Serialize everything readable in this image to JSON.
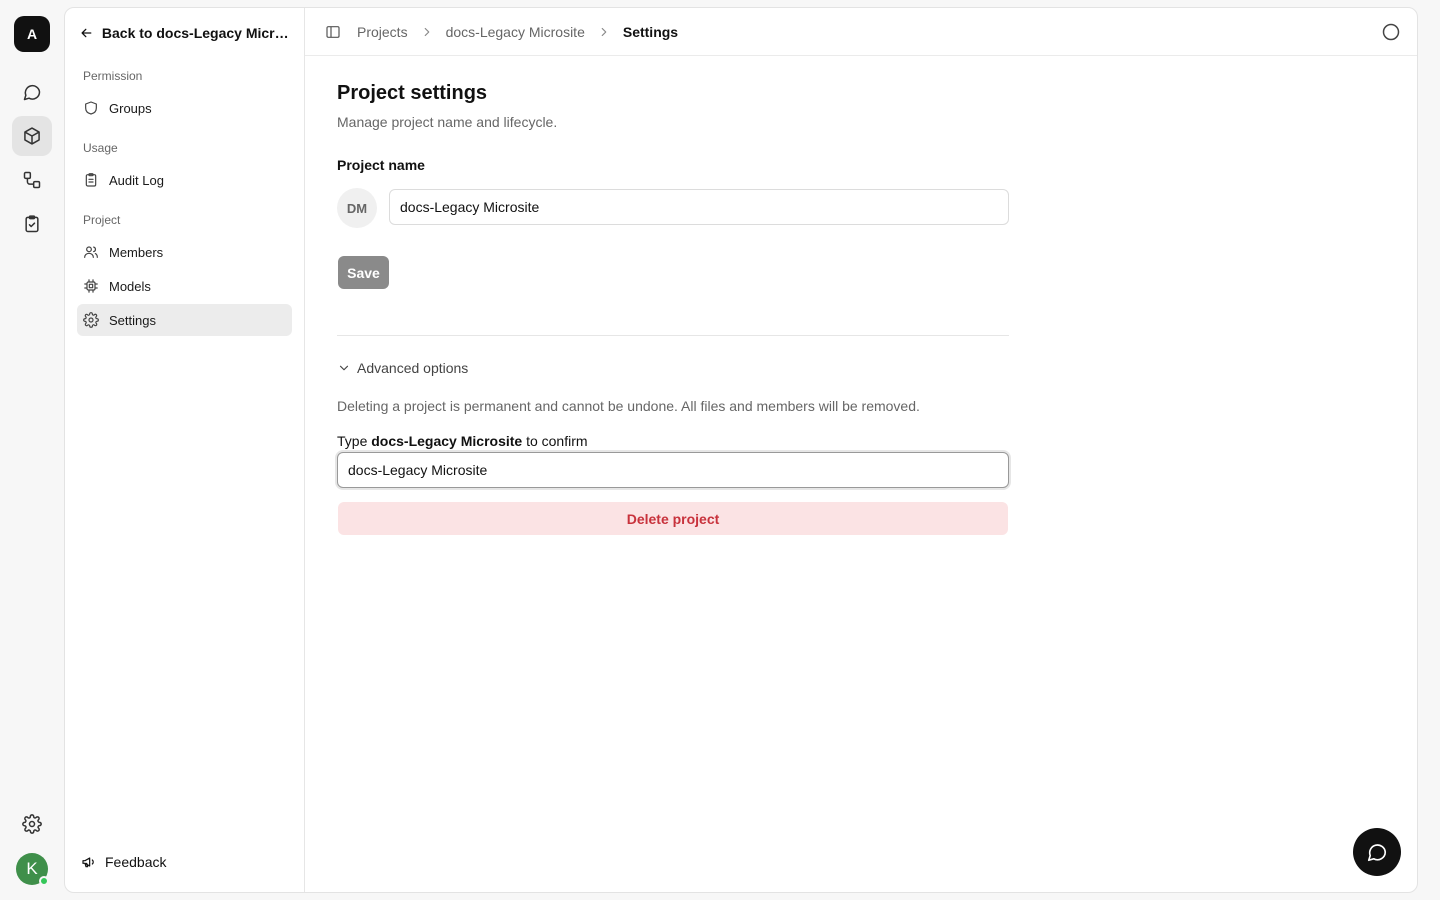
{
  "rail": {
    "logo_letter": "A",
    "avatar_letter": "K",
    "icons": [
      "chat-icon",
      "cube-icon",
      "workflow-icon",
      "clipboard-check-icon",
      "gear-icon"
    ]
  },
  "sidebar": {
    "back_label": "Back to docs-Legacy Microsite",
    "sections": {
      "permission": "Permission",
      "usage": "Usage",
      "project": "Project"
    },
    "items": {
      "groups": "Groups",
      "audit_log": "Audit Log",
      "members": "Members",
      "models": "Models",
      "settings": "Settings"
    },
    "active_item": "Settings",
    "feedback": "Feedback"
  },
  "breadcrumb": {
    "items": [
      "Projects",
      "docs-Legacy Microsite",
      "Settings"
    ]
  },
  "content": {
    "title": "Project settings",
    "subtitle": "Manage project name and lifecycle.",
    "name_label": "Project name",
    "initials": "DM",
    "name_value": "docs-Legacy Microsite",
    "save_label": "Save",
    "advanced_label": "Advanced options",
    "warning": "Deleting a project is permanent and cannot be undone. All files and members will be removed.",
    "confirm_prefix": "Type ",
    "confirm_name": "docs-Legacy Microsite",
    "confirm_suffix": " to confirm",
    "confirm_value": "docs-Legacy Microsite",
    "delete_label": "Delete project"
  },
  "colors": {
    "delete_bg": "#fbe3e4",
    "delete_text": "#c8323c",
    "avatar": "#3f8f4a",
    "online": "#35c759"
  }
}
